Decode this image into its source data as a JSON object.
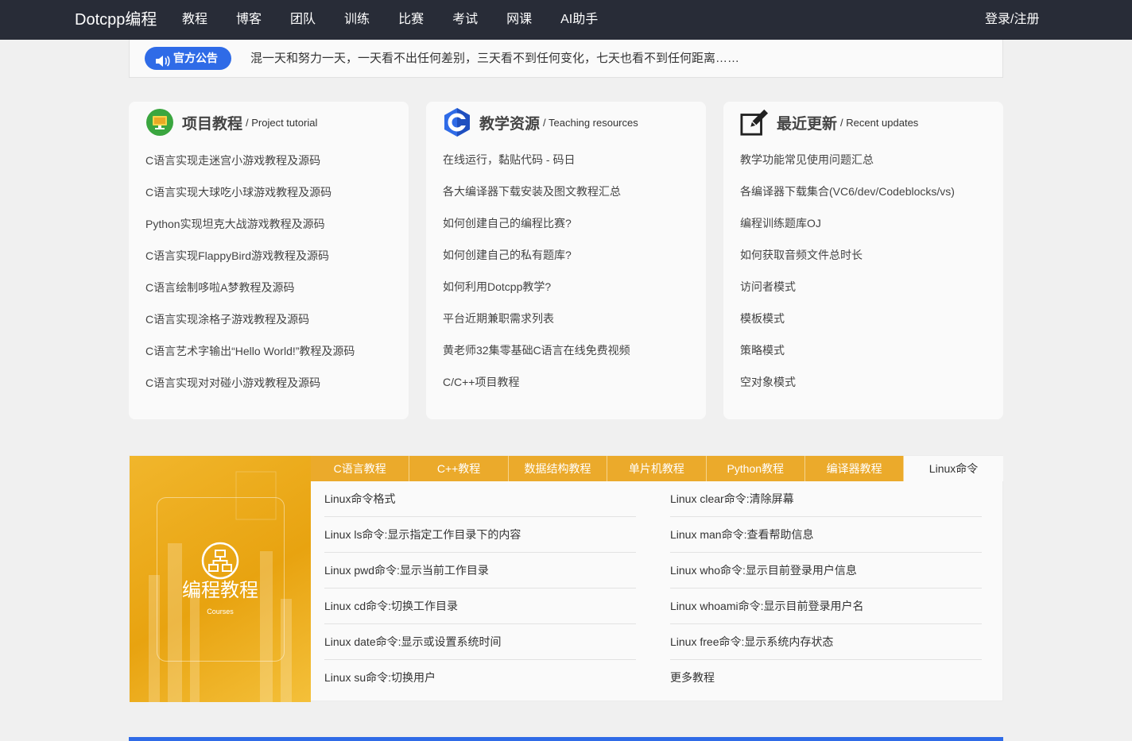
{
  "nav": {
    "brand": "Dotcpp编程",
    "links": [
      "教程",
      "博客",
      "团队",
      "训练",
      "比赛",
      "考试",
      "网课",
      "AI助手"
    ],
    "login": "登录/注册"
  },
  "notice": {
    "badge": "官方公告",
    "text": "混一天和努力一天，一天看不出任何差别，三天看不到任何变化，七天也看不到任何距离……"
  },
  "cards": [
    {
      "title": "项目教程",
      "subtitle": "/ Project tutorial",
      "icon": "monitor-icon",
      "items": [
        "C语言实现走迷宫小游戏教程及源码",
        "C语言实现大球吃小球游戏教程及源码",
        "Python实现坦克大战游戏教程及源码",
        "C语言实现FlappyBird游戏教程及源码",
        "C语言绘制哆啦A梦教程及源码",
        "C语言实现涂格子游戏教程及源码",
        "C语言艺术字输出“Hello World!”教程及源码",
        "C语言实现对对碰小游戏教程及源码"
      ]
    },
    {
      "title": "教学资源",
      "subtitle": "/ Teaching resources",
      "icon": "c-language-icon",
      "items": [
        "在线运行，黏贴代码 - 码日",
        "各大编译器下载安装及图文教程汇总",
        "如何创建自己的编程比赛?",
        "如何创建自己的私有题库?",
        "如何利用Dotcpp教学?",
        "平台近期兼职需求列表",
        "黄老师32集零基础C语言在线免费视频",
        "C/C++项目教程"
      ]
    },
    {
      "title": "最近更新",
      "subtitle": "/ Recent updates",
      "icon": "edit-icon",
      "items": [
        "教学功能常见使用问题汇总",
        "各编译器下载集合(VC6/dev/Codeblocks/vs)",
        "编程训练题库OJ",
        "如何获取音频文件总时长",
        "访问者模式",
        "模板模式",
        "策略模式",
        "空对象模式"
      ]
    }
  ],
  "tutorials": {
    "banner_title": "编程教程",
    "banner_sub": "Courses",
    "tabs": [
      "C语言教程",
      "C++教程",
      "数据结构教程",
      "单片机教程",
      "Python教程",
      "编译器教程",
      "Linux命令"
    ],
    "active_tab": "Linux命令",
    "left": [
      "Linux命令格式",
      "Linux ls命令:显示指定工作目录下的内容",
      "Linux pwd命令:显示当前工作目录",
      "Linux cd命令:切换工作目录",
      "Linux date命令:显示或设置系统时间",
      "Linux su命令:切换用户"
    ],
    "right": [
      "Linux clear命令:清除屏幕",
      "Linux man命令:查看帮助信息",
      "Linux who命令:显示目前登录用户信息",
      "Linux whoami命令:显示目前登录用户名",
      "Linux free命令:显示系统内存状态",
      "更多教程"
    ]
  },
  "colors": {
    "nav_bg": "#282c37",
    "accent_blue": "#2f6be7",
    "tab_orange": "#ebaa2b"
  }
}
